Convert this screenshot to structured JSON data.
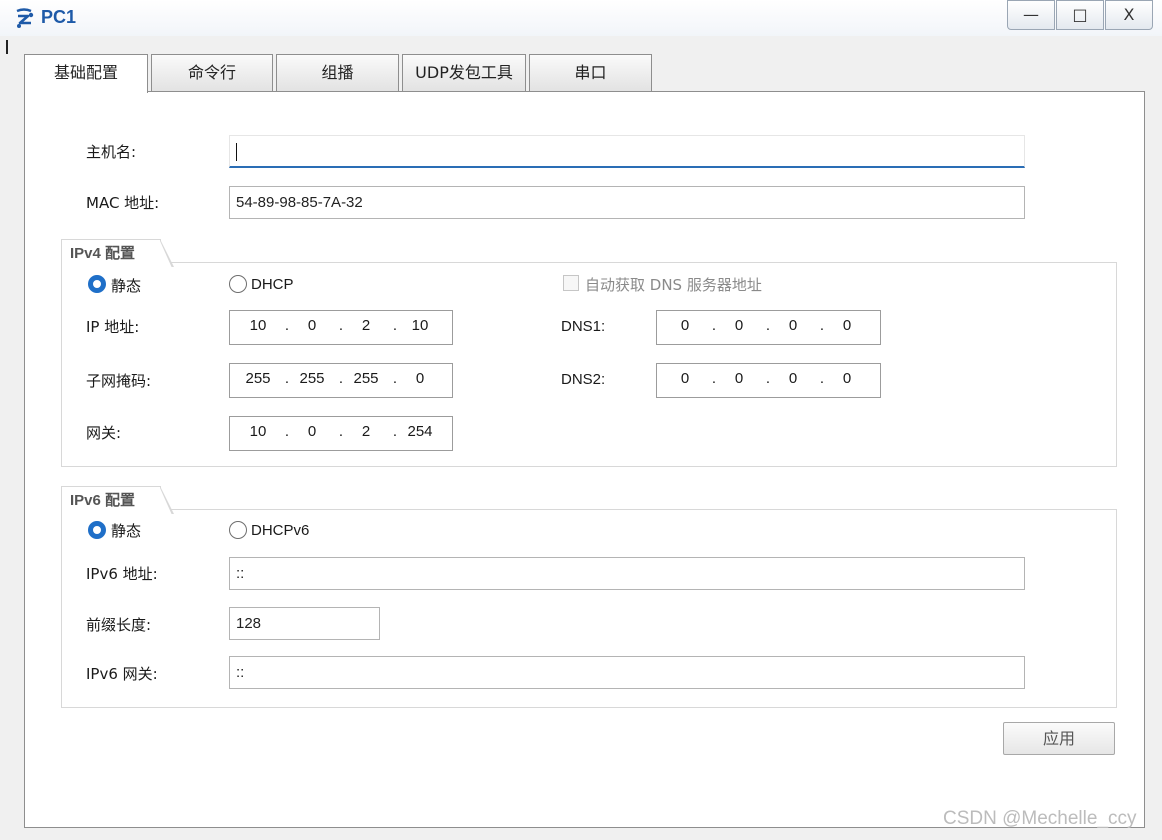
{
  "window": {
    "title": "PC1",
    "minimize_glyph": "—",
    "maximize_glyph": "□",
    "close_glyph": "X"
  },
  "tabs": [
    {
      "label": "基础配置",
      "active": true
    },
    {
      "label": "命令行",
      "active": false
    },
    {
      "label": "组播",
      "active": false
    },
    {
      "label": "UDP发包工具",
      "active": false
    },
    {
      "label": "串口",
      "active": false
    }
  ],
  "host": {
    "hostname_label": "主机名:",
    "hostname_value": "",
    "mac_label": "MAC 地址:",
    "mac_value": "54-89-98-85-7A-32"
  },
  "ipv4": {
    "group_title": "IPv4 配置",
    "static_label": "静态",
    "dhcp_label": "DHCP",
    "selected_mode": "static",
    "auto_dns_label": "自动获取 DNS 服务器地址",
    "auto_dns_checked": false,
    "ip_label": "IP 地址:",
    "ip": [
      "10",
      "0",
      "2",
      "10"
    ],
    "mask_label": "子网掩码:",
    "mask": [
      "255",
      "255",
      "255",
      "0"
    ],
    "gateway_label": "网关:",
    "gateway": [
      "10",
      "0",
      "2",
      "254"
    ],
    "dns1_label": "DNS1:",
    "dns1": [
      "0",
      "0",
      "0",
      "0"
    ],
    "dns2_label": "DNS2:",
    "dns2": [
      "0",
      "0",
      "0",
      "0"
    ]
  },
  "ipv6": {
    "group_title": "IPv6 配置",
    "static_label": "静态",
    "dhcp_label": "DHCPv6",
    "selected_mode": "static",
    "address_label": "IPv6 地址:",
    "address_value": "::",
    "prefix_label": "前缀长度:",
    "prefix_value": "128",
    "gateway_label": "IPv6 网关:",
    "gateway_value": "::"
  },
  "apply_label": "应用",
  "watermark": "CSDN @Mechelle_ccy",
  "colors": {
    "accent": "#1f6fc8",
    "title": "#1e5aa8",
    "focus_underline": "#2a6db5"
  },
  "icons": {
    "app": "network-pc-icon"
  }
}
